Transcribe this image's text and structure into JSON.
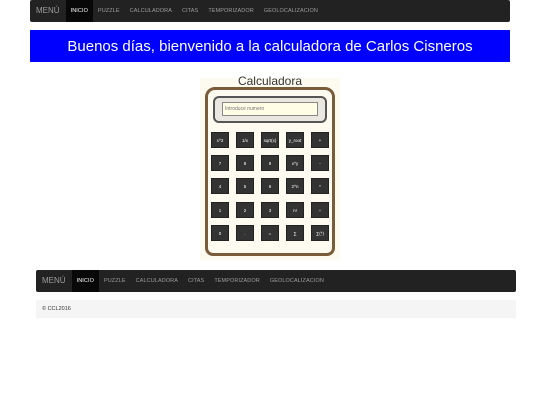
{
  "top_nav": {
    "brand": "MENÚ",
    "items": [
      "INICIO",
      "PUZZLE",
      "CALCULADORA",
      "CITAS",
      "TEMPORIZADOR",
      "GEOLOCALIZACION"
    ]
  },
  "banner": {
    "text": "Buenos días, bienvenido a la calculadora de Carlos Cisneros"
  },
  "calculator": {
    "title": "Calculadora",
    "placeholder": "Introduce numero",
    "buttons": [
      [
        "x^2",
        "1/x",
        "sqrt(x)",
        "y_root",
        "+"
      ],
      [
        "7",
        "8",
        "9",
        "x^y",
        "-"
      ],
      [
        "4",
        "5",
        "6",
        "2^n",
        "*"
      ],
      [
        "1",
        "2",
        "3",
        "n!",
        "÷"
      ],
      [
        "0",
        ".",
        "=",
        "∑",
        "∑(*)"
      ]
    ]
  },
  "bottom_nav": {
    "brand": "MENÚ",
    "items": [
      "INICIO",
      "PUZZLE",
      "CALCULADORA",
      "CITAS",
      "TEMPORIZADOR",
      "GEOLOCALIZACION"
    ]
  },
  "footer": {
    "text": "© CCL2016"
  },
  "colors": {
    "banner": "#0000ff",
    "navbar": "#222222",
    "frame": "#7b5c3a"
  }
}
